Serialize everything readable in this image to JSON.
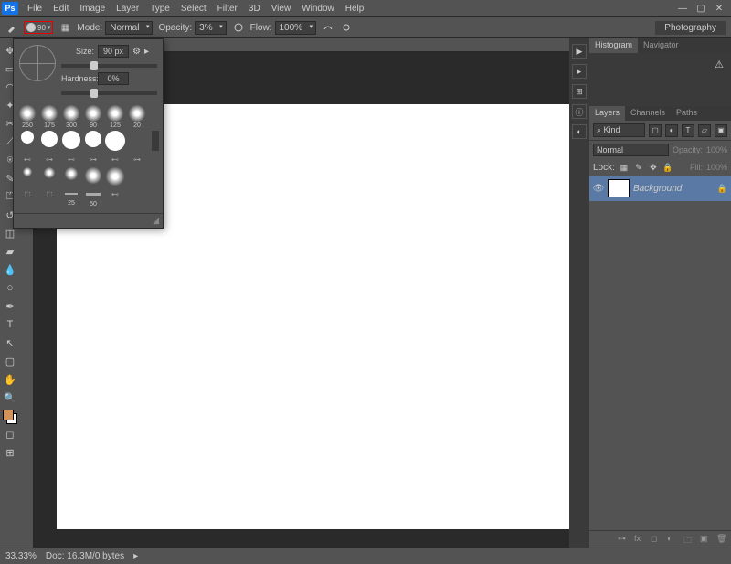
{
  "app": {
    "logo": "Ps"
  },
  "menu": [
    "File",
    "Edit",
    "Image",
    "Layer",
    "Type",
    "Select",
    "Filter",
    "3D",
    "View",
    "Window",
    "Help"
  ],
  "win_buttons": {
    "min": "—",
    "max": "▢",
    "close": "✕"
  },
  "options": {
    "brush_size": "90",
    "mode_label": "Mode:",
    "mode_value": "Normal",
    "opacity_label": "Opacity:",
    "opacity_value": "3%",
    "flow_label": "Flow:",
    "flow_value": "100%",
    "workspace_tag": "Photography"
  },
  "brush_panel": {
    "size_label": "Size:",
    "size_value": "90 px",
    "hardness_label": "Hardness:",
    "hardness_value": "0%",
    "presets_row1": [
      {
        "sz": "250"
      },
      {
        "sz": "175"
      },
      {
        "sz": "300"
      },
      {
        "sz": "90"
      },
      {
        "sz": "125"
      },
      {
        "sz": "20"
      }
    ],
    "presets_row3": [
      {
        "sz": "25"
      },
      {
        "sz": "50"
      }
    ]
  },
  "histogram": {
    "tabs": [
      "Histogram",
      "Navigator"
    ],
    "warn": "⚠"
  },
  "layers": {
    "tabs": [
      "Layers",
      "Channels",
      "Paths"
    ],
    "kind": "⌕ Kind",
    "blend": "Normal",
    "opacity_label": "Opacity:",
    "opacity_value": "100%",
    "lock_label": "Lock:",
    "fill_label": "Fill:",
    "fill_value": "100%",
    "bg_layer": "Background"
  },
  "status": {
    "zoom": "33.33%",
    "doc": "Doc: 16.3M/0 bytes"
  }
}
